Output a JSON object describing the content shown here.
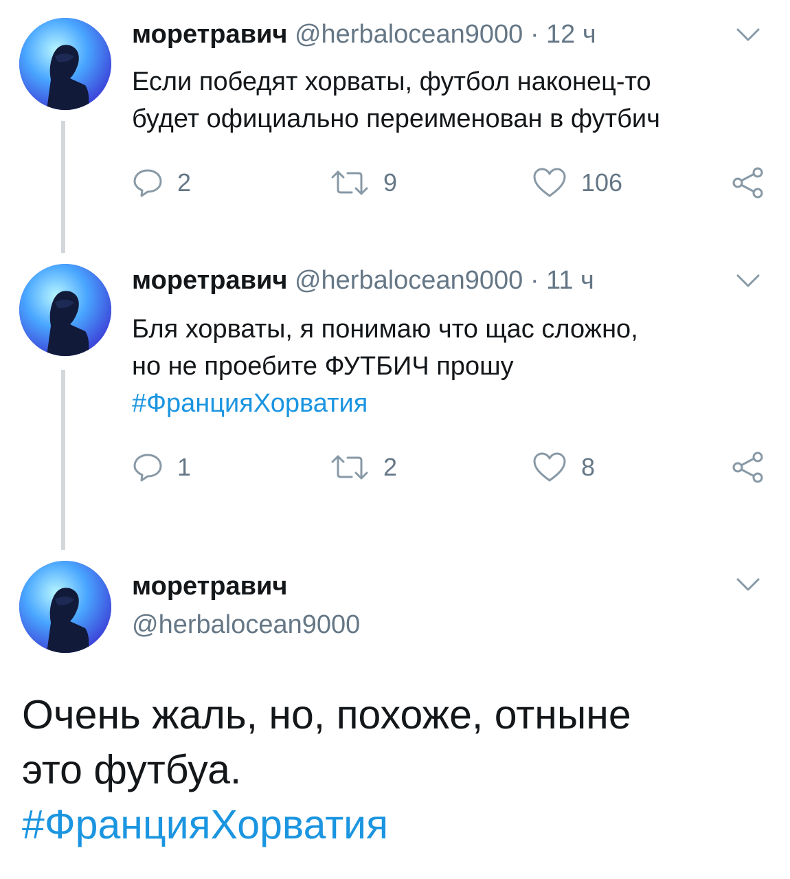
{
  "colors": {
    "link": "#1b95e0",
    "secondary": "#657786",
    "text": "#14171a",
    "thread_line": "#d3d6db"
  },
  "tweets": [
    {
      "name": "моретравич",
      "handle": "@herbalocean9000",
      "dot": "·",
      "time": "12 ч",
      "lines": [
        "Если победят хорваты, футбол наконец-то",
        "будет официально переименован в футбич"
      ],
      "hashtag": "",
      "replies": "2",
      "retweets": "9",
      "likes": "106"
    },
    {
      "name": "моретравич",
      "handle": "@herbalocean9000",
      "dot": "·",
      "time": "11 ч",
      "lines": [
        "Бля хорваты, я понимаю что щас сложно,",
        "но не проебите ФУТБИЧ прошу"
      ],
      "hashtag": "#ФранцияХорватия",
      "replies": "1",
      "retweets": "2",
      "likes": "8"
    }
  ],
  "main_tweet": {
    "name": "моретравич",
    "handle": "@herbalocean9000",
    "lines": [
      "Очень жаль, но, похоже, отныне",
      "это футбуа."
    ],
    "hashtag": "#ФранцияХорватия"
  },
  "icons": [
    "avatar",
    "chevron-down-icon",
    "reply-icon",
    "retweet-icon",
    "like-icon",
    "share-icon"
  ]
}
